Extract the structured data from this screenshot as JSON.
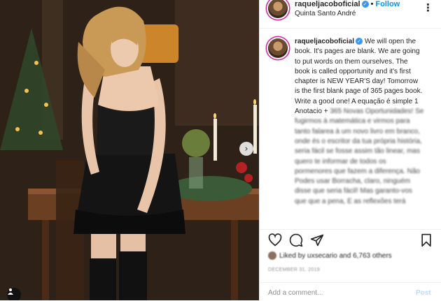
{
  "header": {
    "username": "raqueljacoboficial",
    "follow_label": "Follow",
    "location": "Quinta Santo André"
  },
  "caption": {
    "username": "raqueljacoboficial",
    "text": "We will open the book. It's pages are blank. We are going to put words on them ourselves. The book is called opportunity and it's first chapter is NEW YEAR'S day! Tomorrow is the first blank page of 365 pages book. Write a good one!",
    "text_pt_visible": "A equação é simple 1 Anotacio +",
    "blurred_lines": [
      "365 Novas Oportunidades! Se",
      "fugirmos à matemática e virmos para",
      "tanto falarea à um novo livro",
      "em branco, onde és o escritor da tua",
      "própria história, seria fácil se fosse",
      "assim tão linear, mas quero te",
      "informar de todos os pormenores",
      "que fazem a diferença. Não Podes",
      "usar Borracha, claro, ninguém disse",
      "que seria fácil! Mas garanto-vos que",
      "que a pena, E as reflexões terá"
    ]
  },
  "likes_text": "Liked by uxsecario and 6,763 others",
  "date_text": "DECEMBER 31, 2019",
  "comment": {
    "placeholder": "Add a comment...",
    "post_label": "Post"
  },
  "icons": {
    "verified": "verified-badge-icon",
    "like": "heart-icon",
    "comment": "comment-icon",
    "share": "share-icon",
    "save": "bookmark-icon",
    "next": "chevron-right-icon",
    "tag": "user-tag-icon",
    "more": "more-options-icon"
  },
  "colors": {
    "accent": "#0095f6",
    "post_disabled": "#b2dffc",
    "text": "#262626",
    "muted": "#8e8e8e"
  }
}
